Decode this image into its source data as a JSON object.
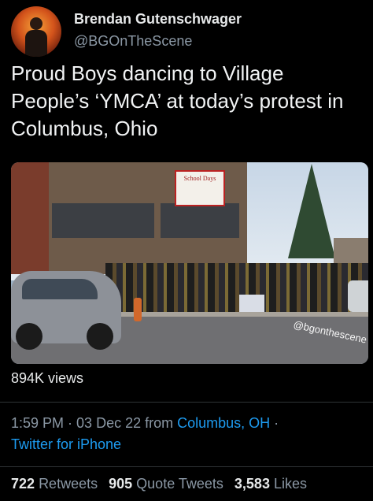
{
  "user": {
    "name": "Brendan Gutenschwager",
    "handle": "@BGOnTheScene"
  },
  "tweet": {
    "text": "Proud Boys dancing to Village People’s ‘YMCA’ at today’s protest in Columbus, Ohio",
    "media": {
      "sign_text": "School Days",
      "watermark": "@bgonthescene"
    },
    "views": "894K views",
    "time": "1:59 PM",
    "sep1": " · ",
    "date": "03 Dec 22",
    "from_label": " from ",
    "location": "Columbus, OH",
    "sep2": " · ",
    "source": "Twitter for iPhone"
  },
  "stats": {
    "retweets_count": "722",
    "retweets_label": "Retweets",
    "quotes_count": "905",
    "quotes_label": "Quote Tweets",
    "likes_count": "3,583",
    "likes_label": "Likes"
  },
  "colors": {
    "background": "#000000",
    "primary_text": "#e7e9ea",
    "secondary_text": "#8b98a5",
    "link": "#1d9bf0"
  }
}
